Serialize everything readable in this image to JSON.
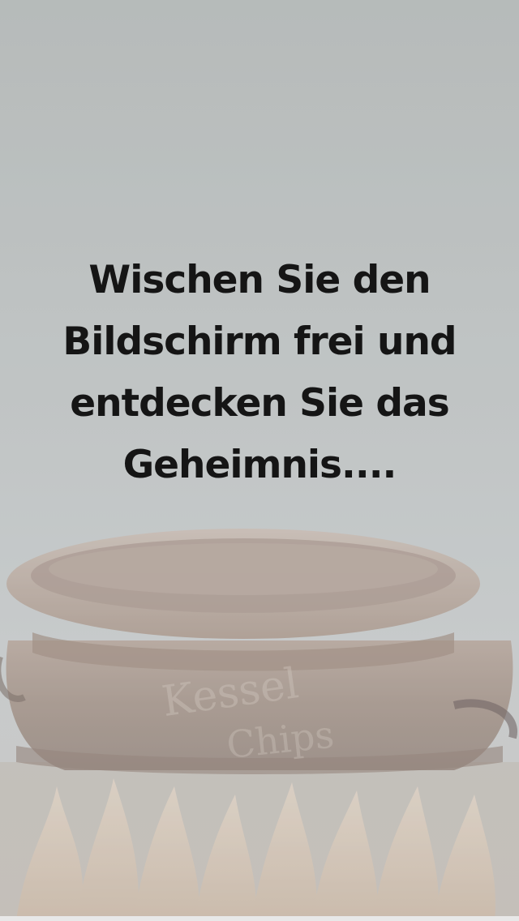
{
  "scratch_screen": {
    "instruction": "Wischen Sie den Bildschirm frei und entdecken Sie das Geheimnis....",
    "hidden_image": {
      "icon": "cauldron-over-fire",
      "embossed_text": [
        "Kessel",
        "Chips"
      ]
    },
    "colors": {
      "overlay": "#bfc3c4",
      "text": "#151515",
      "copper": "#8a6a55",
      "flame": "#d9c8b6"
    }
  }
}
